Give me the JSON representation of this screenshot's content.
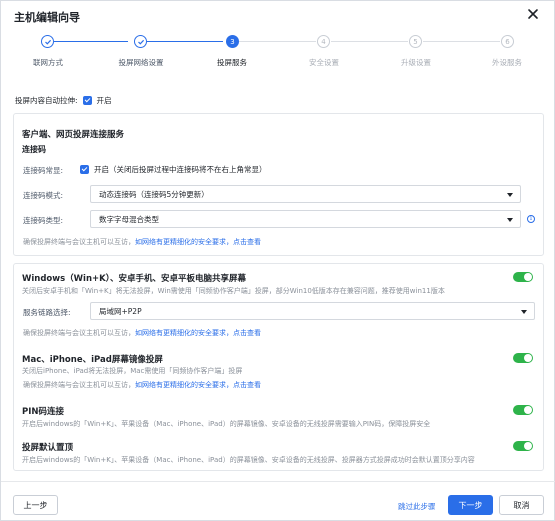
{
  "dialog": {
    "title": "主机编辑向导"
  },
  "steps": [
    {
      "label": "联网方式",
      "number": "1",
      "state": "done"
    },
    {
      "label": "投屏网络设置",
      "number": "2",
      "state": "done"
    },
    {
      "label": "投屏服务",
      "number": "3",
      "state": "active"
    },
    {
      "label": "安全设置",
      "number": "4",
      "state": "todo"
    },
    {
      "label": "升级设置",
      "number": "5",
      "state": "todo"
    },
    {
      "label": "外设服务",
      "number": "6",
      "state": "todo"
    }
  ],
  "auto_pull": {
    "label": "投屏内容自动拉伸:",
    "checkbox_label": "开启"
  },
  "client_card": {
    "title": "客户端、网页投屏连接服务",
    "subtitle": "连接码",
    "always_on": {
      "label": "连接码常显:",
      "checkbox_label": "开启（关闭后投屏过程中连接码将不在右上角常显）"
    },
    "mode": {
      "label": "连接码模式:",
      "value": "动态连接码（连接码5分钟更新）"
    },
    "type": {
      "label": "连接码类型:",
      "value": "数字字母混合类型"
    },
    "note": "确保投屏终端与会议主机可以互访，",
    "note_link": "如网络有更精细化的安全要求，点击查看"
  },
  "services_card": {
    "windows": {
      "title": "Windows（Win+K）、安卓手机、安卓平板电脑共享屏幕",
      "desc": "关闭后安卓手机和「Win+K」将无法投屏，Win需使用「同频协作客户端」投屏，部分Win10低版本存在兼容问题，推荐使用win11版本",
      "link_label": "服务链路选择:",
      "link_value": "局域网+P2P",
      "note": "确保投屏终端与会议主机可以互访，",
      "note_link": "如网络有更精细化的安全要求，点击查看"
    },
    "mac": {
      "title": "Mac、iPhone、iPad屏幕镜像投屏",
      "desc": "关闭后iPhone、iPad将无法投屏，Mac需使用「同频协作客户端」投屏",
      "note": "确保投屏终端与会议主机可以互访，",
      "note_link": "如网络有更精细化的安全要求，点击查看"
    },
    "pin": {
      "title": "PIN码连接",
      "desc": "开启后windows的「Win+K」、苹果设备（Mac、iPhone、iPad）的屏幕镜像、安卓设备的无线投屏需要输入PIN码，保障投屏安全"
    },
    "default_top": {
      "title": "投屏默认置顶",
      "desc": "开启后windows的「Win+K」、苹果设备（Mac、iPhone、iPad）的屏幕镜像、安卓设备的无线投屏、投屏器方式投屏成功时会默认置顶分享内容"
    }
  },
  "footer": {
    "prev": "上一步",
    "skip": "跳过此步骤",
    "next": "下一步",
    "cancel": "取消"
  },
  "colors": {
    "primary": "#2a6ee8",
    "toggle_on": "#2eb34a"
  }
}
